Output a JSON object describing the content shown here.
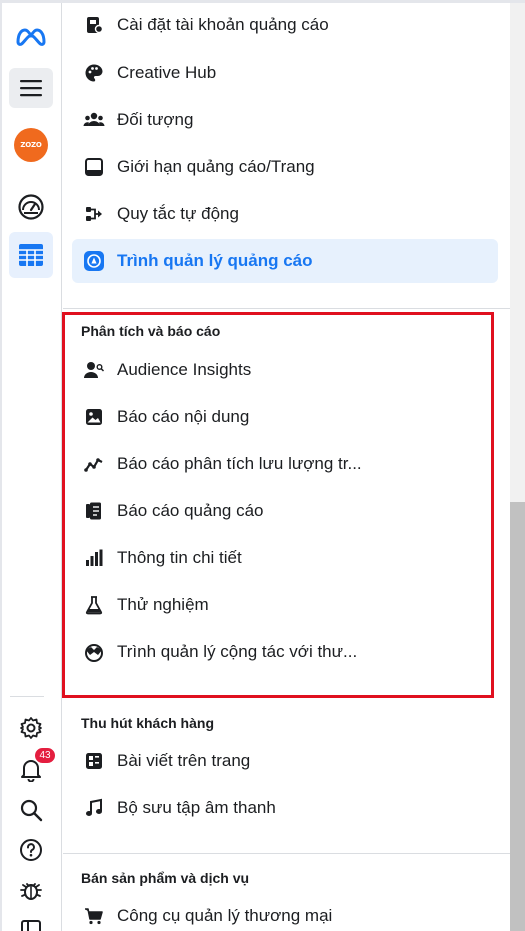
{
  "rail": {
    "avatar_text": "ZOZO",
    "notification_count": "43",
    "accent": "#1877f2"
  },
  "menu_top": [
    {
      "label": "Cài đặt tài khoản quảng cáo",
      "icon": "ad-account-settings-icon"
    },
    {
      "label": "Creative Hub",
      "icon": "palette-icon"
    },
    {
      "label": "Đối tượng",
      "icon": "people-icon"
    },
    {
      "label": "Giới hạn quảng cáo/Trang",
      "icon": "ad-limit-icon"
    },
    {
      "label": "Quy tắc tự động",
      "icon": "automated-rules-icon"
    },
    {
      "label": "Trình quản lý quảng cáo",
      "icon": "ads-manager-icon",
      "active": true
    }
  ],
  "sections": [
    {
      "title": "Phân tích và báo cáo",
      "items": [
        {
          "label": "Audience Insights",
          "icon": "audience-insights-icon"
        },
        {
          "label": "Báo cáo nội dung",
          "icon": "image-icon"
        },
        {
          "label": "Báo cáo phân tích lưu lượng tr...",
          "icon": "trend-line-icon"
        },
        {
          "label": "Báo cáo quảng cáo",
          "icon": "report-icon"
        },
        {
          "label": "Thông tin chi tiết",
          "icon": "bar-chart-icon"
        },
        {
          "label": "Thử nghiệm",
          "icon": "flask-icon"
        },
        {
          "label": "Trình quản lý cộng tác với thư...",
          "icon": "collaboration-icon"
        }
      ]
    },
    {
      "title": "Thu hút khách hàng",
      "items": [
        {
          "label": "Bài viết trên trang",
          "icon": "page-posts-icon"
        },
        {
          "label": "Bộ sưu tập âm thanh",
          "icon": "music-note-icon"
        }
      ]
    },
    {
      "title": "Bán sản phẩm và dịch vụ",
      "items": [
        {
          "label": "Công cụ quản lý thương mại",
          "icon": "shopping-cart-icon"
        }
      ]
    }
  ],
  "highlight_color": "#e0101f"
}
